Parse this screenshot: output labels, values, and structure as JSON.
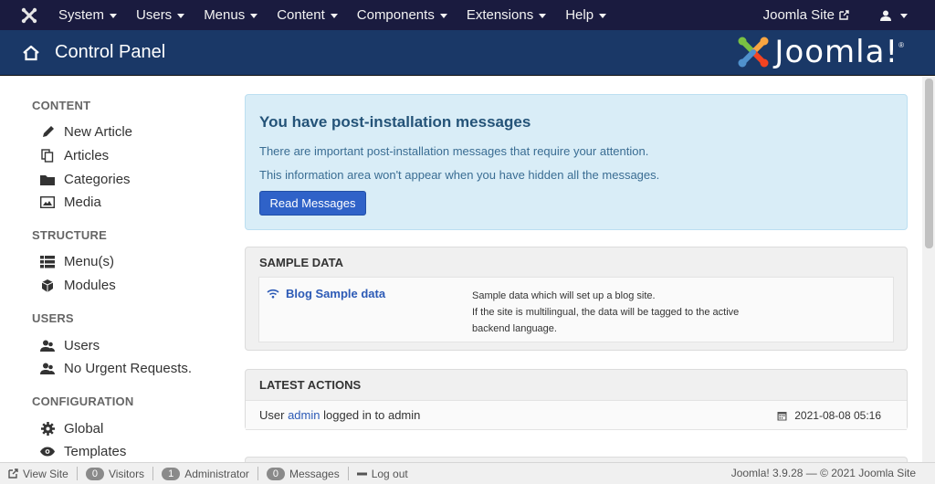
{
  "topnav": {
    "menus": [
      {
        "label": "System"
      },
      {
        "label": "Users"
      },
      {
        "label": "Menus"
      },
      {
        "label": "Content"
      },
      {
        "label": "Components"
      },
      {
        "label": "Extensions"
      },
      {
        "label": "Help"
      }
    ],
    "site_link": "Joomla Site"
  },
  "header": {
    "title": "Control Panel",
    "brand": "Joomla!"
  },
  "sidebar": {
    "sections": [
      {
        "title": "CONTENT",
        "items": [
          {
            "label": "New Article",
            "icon": "pencil-icon"
          },
          {
            "label": "Articles",
            "icon": "copy-icon"
          },
          {
            "label": "Categories",
            "icon": "folder-icon"
          },
          {
            "label": "Media",
            "icon": "image-icon"
          }
        ]
      },
      {
        "title": "STRUCTURE",
        "items": [
          {
            "label": "Menu(s)",
            "icon": "list-icon"
          },
          {
            "label": "Modules",
            "icon": "cube-icon"
          }
        ]
      },
      {
        "title": "USERS",
        "items": [
          {
            "label": "Users",
            "icon": "users-icon"
          },
          {
            "label": "No Urgent Requests.",
            "icon": "users-icon"
          }
        ]
      },
      {
        "title": "CONFIGURATION",
        "items": [
          {
            "label": "Global",
            "icon": "gear-icon"
          },
          {
            "label": "Templates",
            "icon": "eye-icon"
          }
        ]
      }
    ]
  },
  "alert": {
    "title": "You have post-installation messages",
    "line1": "There are important post-installation messages that require your attention.",
    "line2": "This information area won't appear when you have hidden all the messages.",
    "button": "Read Messages"
  },
  "sample_data": {
    "title": "SAMPLE DATA",
    "link": "Blog Sample data",
    "desc_lines": [
      "Sample data which will set up a blog site.",
      "If the site is multilingual, the data will be tagged to the active",
      "backend language."
    ]
  },
  "latest_actions": {
    "title": "LATEST ACTIONS",
    "row": {
      "prefix": "User",
      "user": "admin",
      "suffix": "logged in to admin",
      "date": "2021-08-08 05:16"
    }
  },
  "footer": {
    "view_site": "View Site",
    "visitors_count": "0",
    "visitors_label": "Visitors",
    "admin_count": "1",
    "admin_label": "Administrator",
    "messages_count": "0",
    "messages_label": "Messages",
    "logout": "Log out",
    "version": "Joomla! 3.9.28  —  © 2021 Joomla Site"
  },
  "colors": {
    "topnav_bg": "#1a1b3f",
    "header_bg": "#1a3867",
    "alert_bg": "#d9edf7",
    "primary_button": "#2f62c8",
    "link": "#2c5ab6"
  }
}
